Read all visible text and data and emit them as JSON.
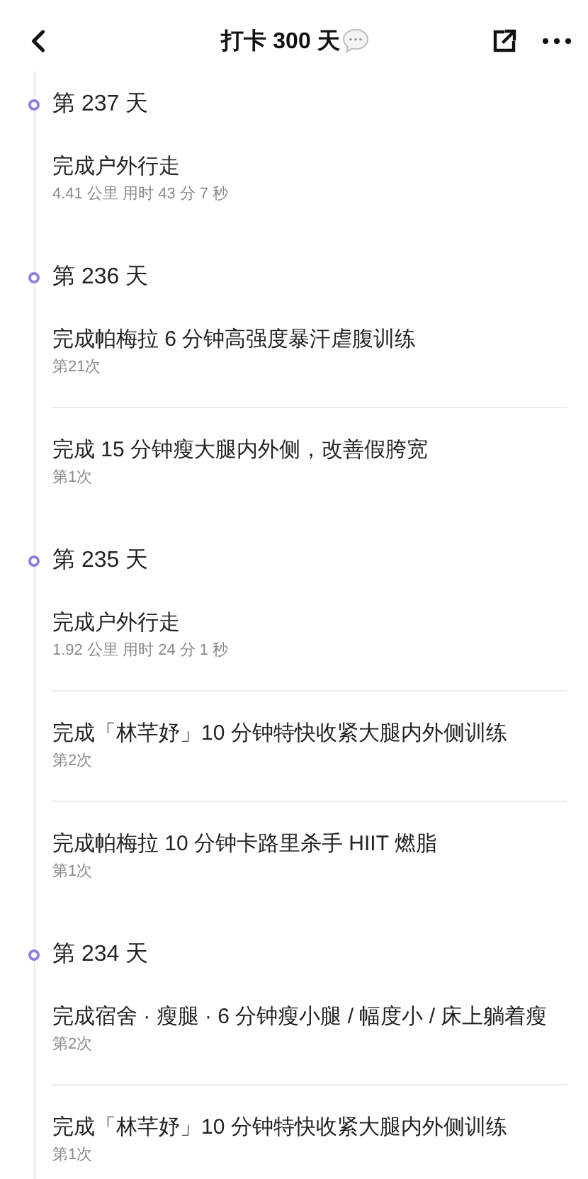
{
  "nav": {
    "title": "打卡 300 天"
  },
  "days": [
    {
      "title": "第 237 天",
      "entries": [
        {
          "title": "完成户外行走",
          "detail": "4.41 公里 用时 43 分 7 秒"
        }
      ]
    },
    {
      "title": "第 236 天",
      "entries": [
        {
          "title": "完成帕梅拉 6 分钟高强度暴汗虐腹训练",
          "detail": "第21次"
        },
        {
          "title": "完成 15 分钟瘦大腿内外侧，改善假胯宽",
          "detail": "第1次"
        }
      ]
    },
    {
      "title": "第 235 天",
      "entries": [
        {
          "title": "完成户外行走",
          "detail": "1.92 公里 用时 24 分 1 秒"
        },
        {
          "title": "完成「林芊妤」10 分钟特快收紧大腿内外侧训练",
          "detail": "第2次"
        },
        {
          "title": "完成帕梅拉 10 分钟卡路里杀手 HIIT 燃脂",
          "detail": "第1次"
        }
      ]
    },
    {
      "title": "第 234 天",
      "entries": [
        {
          "title": "完成宿舍 · 瘦腿 · 6 分钟瘦小腿 / 幅度小 / 床上躺着瘦",
          "detail": "第2次"
        },
        {
          "title": "完成「林芊妤」10 分钟特快收紧大腿内外侧训练",
          "detail": "第1次"
        }
      ]
    }
  ]
}
